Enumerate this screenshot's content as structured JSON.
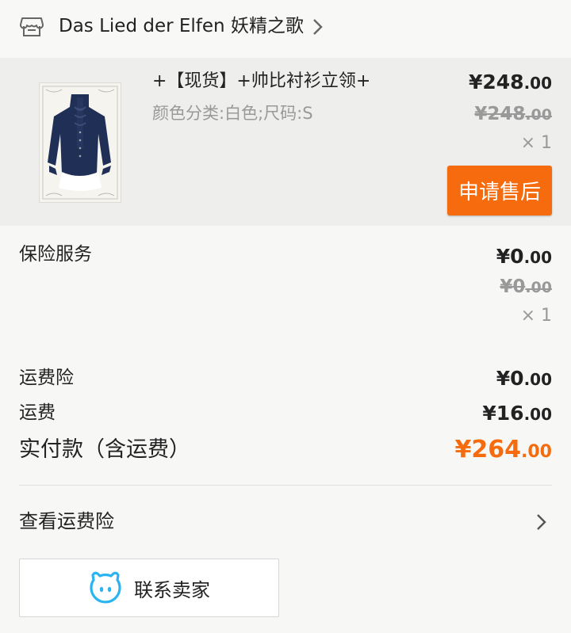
{
  "shop": {
    "name": "Das Lied der Elfen 妖精之歌",
    "icon": "shop-icon"
  },
  "product": {
    "title": "+【现货】+帅比衬衫立领+",
    "variant": "颜色分类:白色;尺码:S",
    "price_int": "¥248",
    "price_dec": ".00",
    "old_price_int": "¥248",
    "old_price_dec": ".00",
    "qty": "× 1",
    "after_sale_label": "申请售后"
  },
  "insurance": {
    "label": "保险服务",
    "price_int": "¥0",
    "price_dec": ".00",
    "old_price_int": "¥0",
    "old_price_dec": ".00",
    "qty": "× 1"
  },
  "summary": {
    "shipping_insurance_label": "运费险",
    "shipping_insurance_int": "¥0",
    "shipping_insurance_dec": ".00",
    "shipping_label": "运费",
    "shipping_int": "¥16",
    "shipping_dec": ".00",
    "total_label": "实付款（含运费）",
    "total_int": "¥264",
    "total_dec": ".00"
  },
  "links": {
    "view_shipping_insurance": "查看运费险"
  },
  "contact": {
    "label": "联系卖家"
  },
  "colors": {
    "accent": "#f56b0d",
    "contact_icon": "#2bb4f0"
  }
}
